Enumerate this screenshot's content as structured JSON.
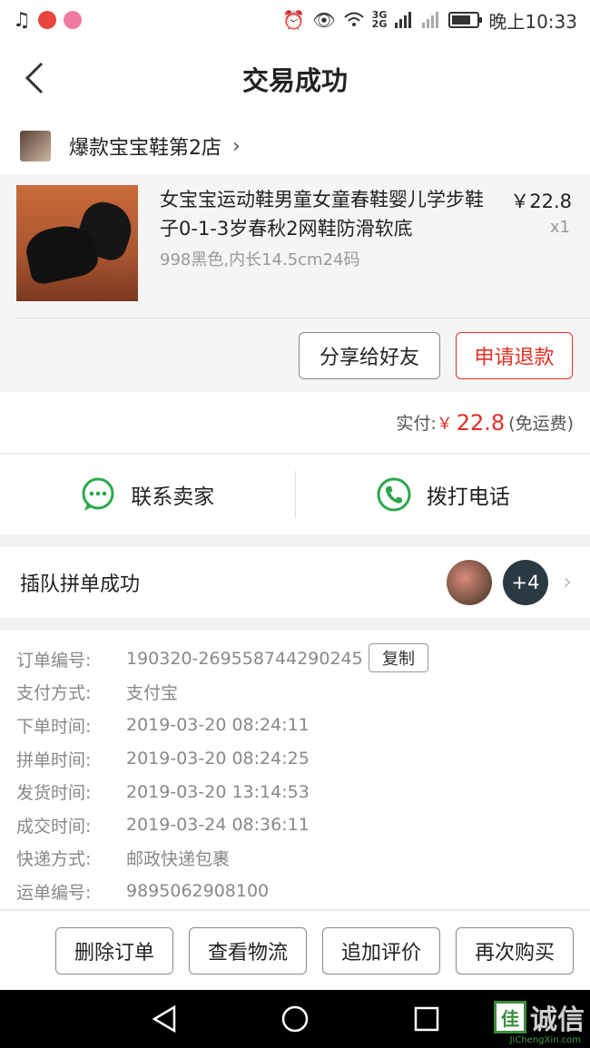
{
  "status_bar": {
    "time": "晚上10:33",
    "signal_label_top": "3G",
    "signal_label_bottom": "2G",
    "battery_fraction": 0.75,
    "icons": [
      "music-note-icon",
      "app-badge-icon",
      "app-badge-icon",
      "alarm-icon",
      "eye-icon",
      "wifi-icon",
      "signal-icon",
      "battery-icon"
    ]
  },
  "header": {
    "title": "交易成功",
    "back_icon": "back-chevron-icon"
  },
  "store": {
    "name": "爆款宝宝鞋第2店",
    "chevron": "›"
  },
  "product": {
    "title": "女宝宝运动鞋男童女童春鞋婴儿学步鞋子0-1-3岁春秋2网鞋防滑软底",
    "price": "￥22.8",
    "quantity": "x1",
    "spec": "998黑色,内长14.5cm24码",
    "share_label": "分享给好友",
    "refund_label": "申请退款"
  },
  "payment": {
    "label": "实付:",
    "currency": "￥",
    "amount": "22.8",
    "shipping_note": "(免运费)"
  },
  "contact": {
    "seller_label": "联系卖家",
    "phone_label": "拨打电话"
  },
  "group_buy": {
    "label": "插队拼单成功",
    "extra_count": "+4"
  },
  "order_details": {
    "copy_label": "复制",
    "rows": [
      {
        "label": "订单编号:",
        "value": "190320-269558744290245"
      },
      {
        "label": "支付方式:",
        "value": "支付宝"
      },
      {
        "label": "下单时间:",
        "value": "2019-03-20 08:24:11"
      },
      {
        "label": "拼单时间:",
        "value": "2019-03-20 08:24:25"
      },
      {
        "label": "发货时间:",
        "value": "2019-03-20 13:14:53"
      },
      {
        "label": "成交时间:",
        "value": "2019-03-24 08:36:11"
      },
      {
        "label": "快递方式:",
        "value": "邮政快递包裹"
      },
      {
        "label": "运单编号:",
        "value": "9895062908100"
      }
    ]
  },
  "actions": {
    "delete_label": "删除订单",
    "logistics_label": "查看物流",
    "review_label": "追加评价",
    "rebuy_label": "再次购买"
  },
  "watermark": {
    "box": "佳",
    "text": "诚信",
    "sub": "JiChengXin.com"
  },
  "colors": {
    "accent": "#e02e24",
    "green": "#2aa84a"
  }
}
